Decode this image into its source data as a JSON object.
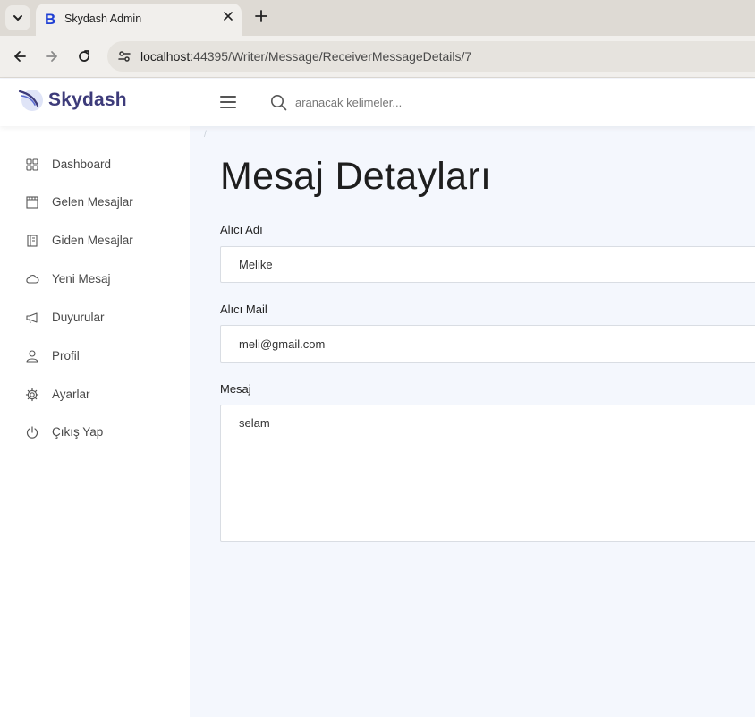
{
  "browser": {
    "tab_title": "Skydash Admin",
    "favicon_letter": "B",
    "url_host": "localhost",
    "url_rest": ":44395/Writer/Message/ReceiverMessageDetails/7"
  },
  "header": {
    "brand": "Skydash",
    "search_placeholder": "aranacak kelimeler..."
  },
  "sidebar": {
    "items": [
      {
        "label": "Dashboard",
        "icon": "grid-icon"
      },
      {
        "label": "Gelen Mesajlar",
        "icon": "inbox-icon"
      },
      {
        "label": "Giden Mesajlar",
        "icon": "outbox-icon"
      },
      {
        "label": "Yeni Mesaj",
        "icon": "cloud-icon"
      },
      {
        "label": "Duyurular",
        "icon": "megaphone-icon"
      },
      {
        "label": "Profil",
        "icon": "user-icon"
      },
      {
        "label": "Ayarlar",
        "icon": "gear-icon"
      },
      {
        "label": "Çıkış Yap",
        "icon": "power-icon"
      }
    ]
  },
  "main": {
    "breadcrumb": "/",
    "title": "Mesaj Detayları",
    "fields": {
      "receiver_name_label": "Alıcı Adı",
      "receiver_name_value": "Melike",
      "receiver_mail_label": "Alıcı Mail",
      "receiver_mail_value": "meli@gmail.com",
      "message_label": "Mesaj",
      "message_value": "selam"
    }
  },
  "colors": {
    "brand": "#3d3b7a",
    "main_bg": "#f4f7fd"
  }
}
